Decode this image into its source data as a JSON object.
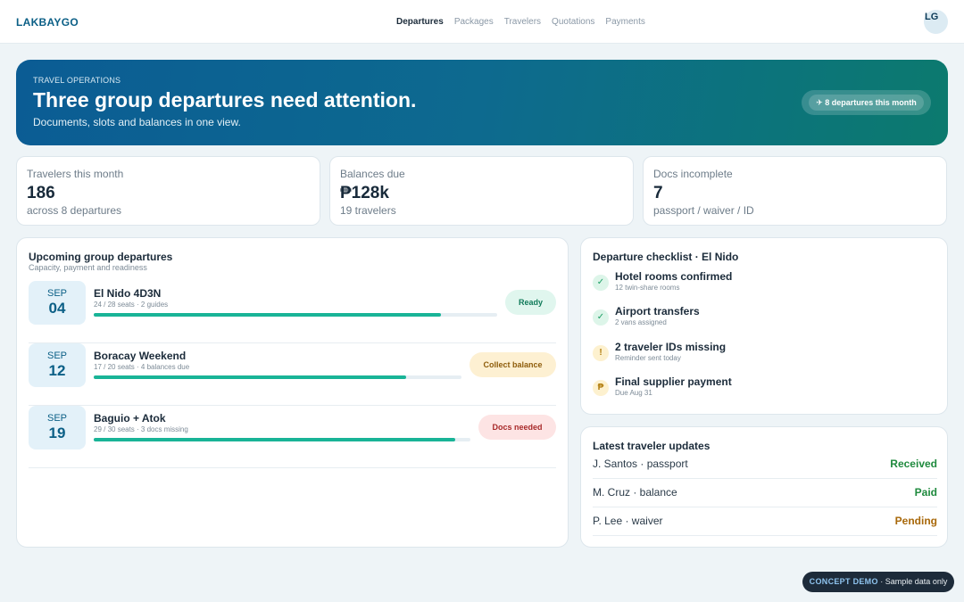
{
  "app": {
    "brand": "LAKBAYGO",
    "avatar_initials": "LG"
  },
  "nav": {
    "items": [
      {
        "label": "Departures",
        "active": true
      },
      {
        "label": "Packages",
        "active": false
      },
      {
        "label": "Travelers",
        "active": false
      },
      {
        "label": "Quotations",
        "active": false
      },
      {
        "label": "Payments",
        "active": false
      }
    ]
  },
  "hero": {
    "eyebrow": "TRAVEL OPERATIONS",
    "title": "Three group departures need attention.",
    "subtitle": "Documents, slots and balances in one view.",
    "pill": "✈ 8 departures this month"
  },
  "stats": [
    {
      "label": "Travelers this month",
      "value": "186",
      "note": "across 8 departures"
    },
    {
      "label": "Balances due",
      "value": "₱128k",
      "note": "19 travelers"
    },
    {
      "label": "Docs incomplete",
      "value": "7",
      "note": "passport / waiver / ID"
    }
  ],
  "departures": {
    "title": "Upcoming group departures",
    "subtitle": "Capacity, payment and readiness",
    "rows": [
      {
        "month": "SEP",
        "day": "04",
        "name": "El Nido 4D3N",
        "meta": "24 / 28 seats · 2 guides",
        "fill_fraction": 0.86,
        "status": "Ready",
        "status_type": "ready"
      },
      {
        "month": "SEP",
        "day": "12",
        "name": "Boracay Weekend",
        "meta": "17 / 20 seats · 4 balances due",
        "fill_fraction": 0.85,
        "status": "Collect balance",
        "status_type": "collect"
      },
      {
        "month": "SEP",
        "day": "19",
        "name": "Baguio + Atok",
        "meta": "29 / 30 seats · 3 docs missing",
        "fill_fraction": 0.96,
        "status": "Docs needed",
        "status_type": "docs"
      }
    ]
  },
  "checklist": {
    "title": "Departure checklist · El Nido",
    "items": [
      {
        "icon": "check-icon",
        "glyph": "✓",
        "kind": "ok",
        "title": "Hotel rooms confirmed",
        "note": "12 twin-share rooms"
      },
      {
        "icon": "check-icon",
        "glyph": "✓",
        "kind": "ok",
        "title": "Airport transfers",
        "note": "2 vans assigned"
      },
      {
        "icon": "alert-icon",
        "glyph": "!",
        "kind": "warn",
        "title": "2 traveler IDs missing",
        "note": "Reminder sent today"
      },
      {
        "icon": "peso-icon",
        "glyph": "₱",
        "kind": "warn",
        "title": "Final supplier payment",
        "note": "Due Aug 31"
      }
    ]
  },
  "updates": {
    "title": "Latest traveler updates",
    "rows": [
      {
        "name": "J. Santos · passport",
        "status": "Received",
        "color": "#1f8a3e"
      },
      {
        "name": "M. Cruz · balance",
        "status": "Paid",
        "color": "#1f8a3e"
      },
      {
        "name": "P. Lee · waiver",
        "status": "Pending",
        "color": "#a8680a"
      }
    ]
  },
  "demo_badge": {
    "tag": "CONCEPT DEMO",
    "text": " · Sample data only"
  }
}
